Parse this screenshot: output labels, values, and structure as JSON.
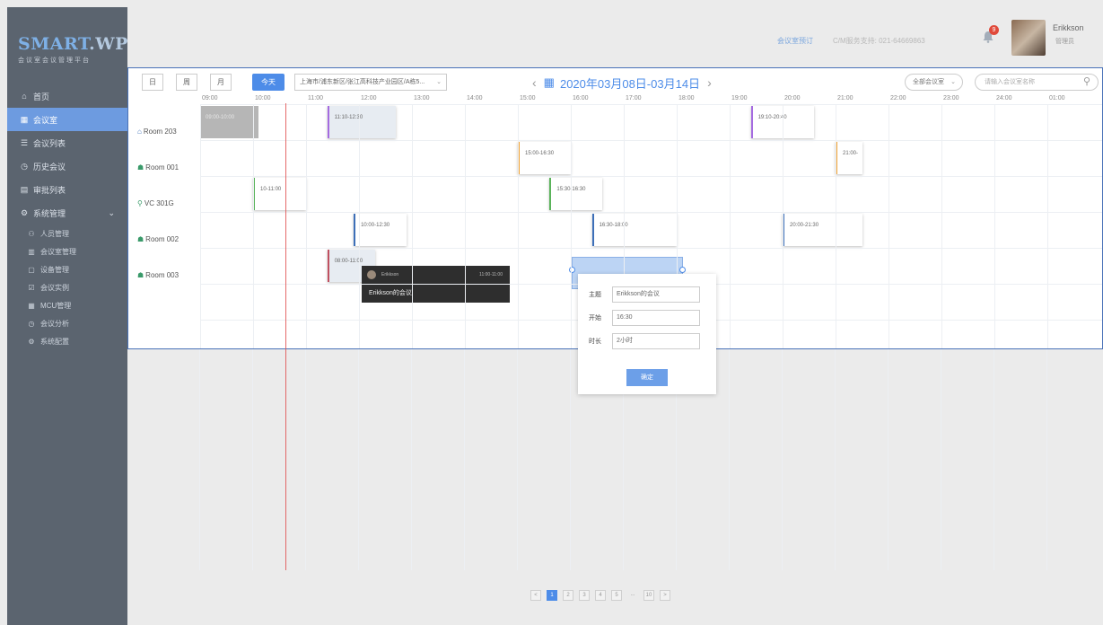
{
  "logo": {
    "main": "SMART",
    "main_accent": ".WP",
    "sub": "会议室会议管理平台"
  },
  "sidebar": {
    "items": [
      {
        "label": "首页",
        "icon": "home-icon",
        "glyph": "⌂"
      },
      {
        "label": "会议室",
        "icon": "calendar-icon",
        "glyph": "▦",
        "active": true
      },
      {
        "label": "会议列表",
        "icon": "list-icon",
        "glyph": "☰"
      },
      {
        "label": "历史会议",
        "icon": "history-icon",
        "glyph": "◷"
      },
      {
        "label": "审批列表",
        "icon": "approval-icon",
        "glyph": "▤"
      },
      {
        "label": "系统管理",
        "icon": "settings-icon",
        "glyph": "⚙"
      }
    ],
    "subitems": [
      {
        "label": "人员管理",
        "icon": "people-icon",
        "glyph": "⚇"
      },
      {
        "label": "会议室管理",
        "icon": "room-icon",
        "glyph": "▥"
      },
      {
        "label": "设备管理",
        "icon": "device-icon",
        "glyph": "▢"
      },
      {
        "label": "会议实例",
        "icon": "instance-icon",
        "glyph": "☑"
      },
      {
        "label": "MCU管理",
        "icon": "mcu-icon",
        "glyph": "▦"
      },
      {
        "label": "会议分析",
        "icon": "analysis-icon",
        "glyph": "◷"
      },
      {
        "label": "系统配置",
        "icon": "config-icon",
        "glyph": "⚙"
      }
    ]
  },
  "header": {
    "link1": "会议室预订",
    "link2": "C/M服务支持: 021-64669863",
    "notification_count": "9",
    "user_name": "Erikkson",
    "user_role": "管理员"
  },
  "toolbar": {
    "view_day": "日",
    "view_week": "周",
    "view_month": "月",
    "today": "今天",
    "location": "上海市/浦东新区/张江高科技产业园区/A栋5...",
    "date_range": "2020年03月08日-03月14日",
    "filter": "全部会议室",
    "search_placeholder": "请输入会议室名称"
  },
  "timeline": {
    "hours": [
      "09:00",
      "10:00",
      "11:00",
      "12:00",
      "13:00",
      "14:00",
      "15:00",
      "16:00",
      "17:00",
      "18:00",
      "19:00",
      "20:00",
      "21:00",
      "22:00",
      "23:00",
      "24:00",
      "01:00"
    ],
    "rooms": [
      {
        "name": "Room 203",
        "icon": "home-icon",
        "glyph": "⌂",
        "color": "#3d6fb8"
      },
      {
        "name": "Room 001",
        "icon": "room-icon",
        "glyph": "☗",
        "color": "#3a9a6a"
      },
      {
        "name": "VC 301G",
        "icon": "location-pin-icon",
        "glyph": "⚲",
        "color": "#3a9a6a"
      },
      {
        "name": "Room 002",
        "icon": "room-icon",
        "glyph": "☗",
        "color": "#3a9a6a"
      },
      {
        "name": "Room 003",
        "icon": "room-icon",
        "glyph": "☗",
        "color": "#3a9a6a"
      }
    ],
    "events": [
      {
        "row": 0,
        "start": 9.0,
        "end": 10.1,
        "label": "09:00-10:00",
        "style": "grey"
      },
      {
        "row": 0,
        "start": 11.4,
        "end": 12.7,
        "label": "11:10-12:30",
        "style": "tinted bar-purple"
      },
      {
        "row": 0,
        "start": 19.4,
        "end": 20.6,
        "label": "19:10-20:40",
        "style": "bar-purple"
      },
      {
        "row": 1,
        "start": 15.0,
        "end": 16.0,
        "label": "15:00-16:30",
        "style": "bar-orange"
      },
      {
        "row": 1,
        "start": 21.0,
        "end": 21.5,
        "label": "21:00-",
        "style": "bar-orange"
      },
      {
        "row": 2,
        "start": 10.0,
        "end": 11.0,
        "label": "10-11:00",
        "style": "bar-green"
      },
      {
        "row": 2,
        "start": 15.6,
        "end": 16.6,
        "label": "15:30-16:30",
        "style": "bar-green"
      },
      {
        "row": 3,
        "start": 11.9,
        "end": 12.9,
        "label": "10:00-12:30",
        "style": "bar-blue"
      },
      {
        "row": 3,
        "start": 16.4,
        "end": 18.0,
        "label": "16:30-18:00",
        "style": "bar-blue"
      },
      {
        "row": 3,
        "start": 20.0,
        "end": 21.5,
        "label": "20:00-21:30",
        "style": "bar-blue"
      },
      {
        "row": 4,
        "start": 11.4,
        "end": 12.3,
        "label": "08:00-11:00",
        "style": "tinted bar-red"
      }
    ]
  },
  "tooltip": {
    "name": "Erikkson",
    "time": "11:00-11:00",
    "title": "Erikkson的会议"
  },
  "popup": {
    "subject_label": "主题",
    "subject_value": "Erikkson的会议",
    "start_label": "开始",
    "start_value": "16:30",
    "duration_label": "时长",
    "duration_value": "2小时",
    "confirm": "确定"
  },
  "pagination": [
    "<",
    "1",
    "2",
    "3",
    "4",
    "5",
    "...",
    "10",
    ">"
  ]
}
